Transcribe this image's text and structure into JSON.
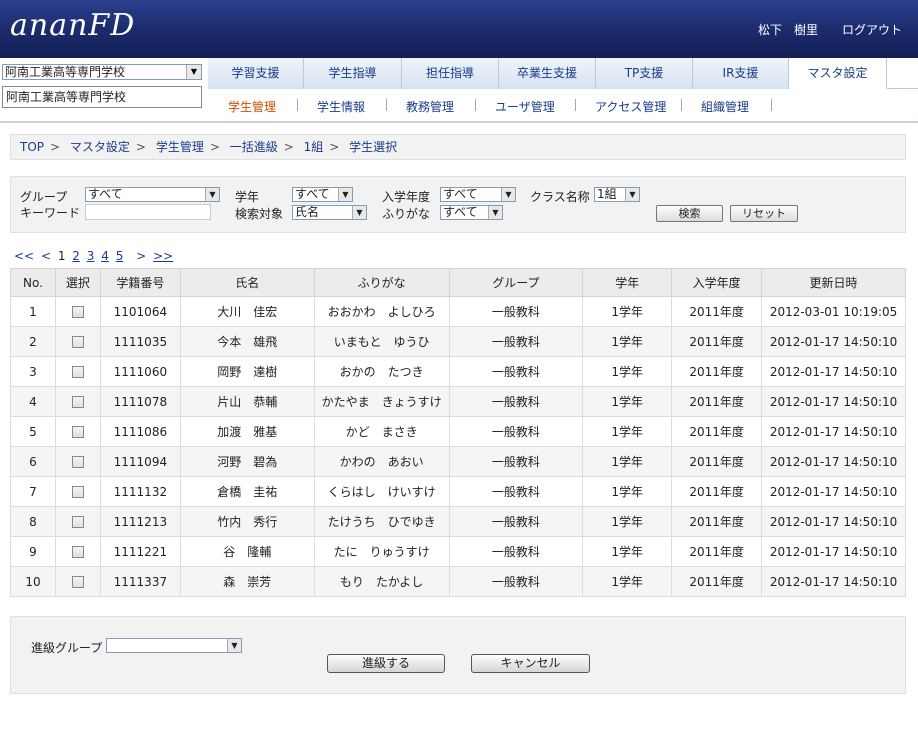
{
  "app": {
    "logo": "ananFD",
    "user_name": "松下　樹里",
    "logout": "ログアウト"
  },
  "school": {
    "selected": "阿南工業高等専門学校",
    "display": "阿南工業高等専門学校"
  },
  "tabs": [
    {
      "label": "学習支援"
    },
    {
      "label": "学生指導"
    },
    {
      "label": "担任指導"
    },
    {
      "label": "卒業生支援"
    },
    {
      "label": "TP支援"
    },
    {
      "label": "IR支援"
    },
    {
      "label": "マスタ設定",
      "active": true
    }
  ],
  "subtabs": [
    {
      "label": "学生管理",
      "active": true
    },
    {
      "label": "学生情報"
    },
    {
      "label": "教務管理"
    },
    {
      "label": "ユーザ管理"
    },
    {
      "label": "アクセス管理"
    },
    {
      "label": "組織管理"
    }
  ],
  "breadcrumb": [
    "TOP",
    "マスタ設定",
    "学生管理",
    "一括進級",
    "1組",
    "学生選択"
  ],
  "search": {
    "group_label": "グループ",
    "group_value": "すべて",
    "keyword_label": "キーワード",
    "keyword_value": "",
    "grade_label": "学年",
    "grade_value": "すべて",
    "target_label": "検索対象",
    "target_value": "氏名",
    "year_label": "入学年度",
    "year_value": "すべて",
    "kana_label": "ふりがな",
    "kana_value": "すべて",
    "class_label": "クラス名称",
    "class_value": "1組",
    "search_button": "検索",
    "reset_button": "リセット"
  },
  "pager": {
    "first": "<<",
    "prev": "<",
    "current": "1",
    "pages": [
      "2",
      "3",
      "4",
      "5"
    ],
    "next": ">",
    "last": ">>"
  },
  "table": {
    "headers": [
      "No.",
      "選択",
      "学籍番号",
      "氏名",
      "ふりがな",
      "グループ",
      "学年",
      "入学年度",
      "更新日時"
    ],
    "rows": [
      {
        "no": "1",
        "id": "1101064",
        "name": "大川　佳宏",
        "kana": "おおかわ　よしひろ",
        "group": "一般教科",
        "grade": "1学年",
        "year": "2011年度",
        "updated": "2012-03-01 10:19:05"
      },
      {
        "no": "2",
        "id": "1111035",
        "name": "今本　雄飛",
        "kana": "いまもと　ゆうひ",
        "group": "一般教科",
        "grade": "1学年",
        "year": "2011年度",
        "updated": "2012-01-17 14:50:10"
      },
      {
        "no": "3",
        "id": "1111060",
        "name": "岡野　達樹",
        "kana": "おかの　たつき",
        "group": "一般教科",
        "grade": "1学年",
        "year": "2011年度",
        "updated": "2012-01-17 14:50:10"
      },
      {
        "no": "4",
        "id": "1111078",
        "name": "片山　恭輔",
        "kana": "かたやま　きょうすけ",
        "group": "一般教科",
        "grade": "1学年",
        "year": "2011年度",
        "updated": "2012-01-17 14:50:10"
      },
      {
        "no": "5",
        "id": "1111086",
        "name": "加渡　雅基",
        "kana": "かど　まさき",
        "group": "一般教科",
        "grade": "1学年",
        "year": "2011年度",
        "updated": "2012-01-17 14:50:10"
      },
      {
        "no": "6",
        "id": "1111094",
        "name": "河野　碧為",
        "kana": "かわの　あおい",
        "group": "一般教科",
        "grade": "1学年",
        "year": "2011年度",
        "updated": "2012-01-17 14:50:10"
      },
      {
        "no": "7",
        "id": "1111132",
        "name": "倉橋　圭祐",
        "kana": "くらはし　けいすけ",
        "group": "一般教科",
        "grade": "1学年",
        "year": "2011年度",
        "updated": "2012-01-17 14:50:10"
      },
      {
        "no": "8",
        "id": "1111213",
        "name": "竹内　秀行",
        "kana": "たけうち　ひでゆき",
        "group": "一般教科",
        "grade": "1学年",
        "year": "2011年度",
        "updated": "2012-01-17 14:50:10"
      },
      {
        "no": "9",
        "id": "1111221",
        "name": "谷　隆輔",
        "kana": "たに　りゅうすけ",
        "group": "一般教科",
        "grade": "1学年",
        "year": "2011年度",
        "updated": "2012-01-17 14:50:10"
      },
      {
        "no": "10",
        "id": "1111337",
        "name": "森　崇芳",
        "kana": "もり　たかよし",
        "group": "一般教科",
        "grade": "1学年",
        "year": "2011年度",
        "updated": "2012-01-17 14:50:10"
      }
    ]
  },
  "bottom": {
    "group_label": "進級グループ",
    "group_value": "",
    "promote_button": "進級する",
    "cancel_button": "キャンセル"
  },
  "colors": {
    "header_bg": "#1a2a6b",
    "link": "#1a3d8a",
    "active_subtab": "#d94a00",
    "panel_bg": "#f2f2f2"
  }
}
